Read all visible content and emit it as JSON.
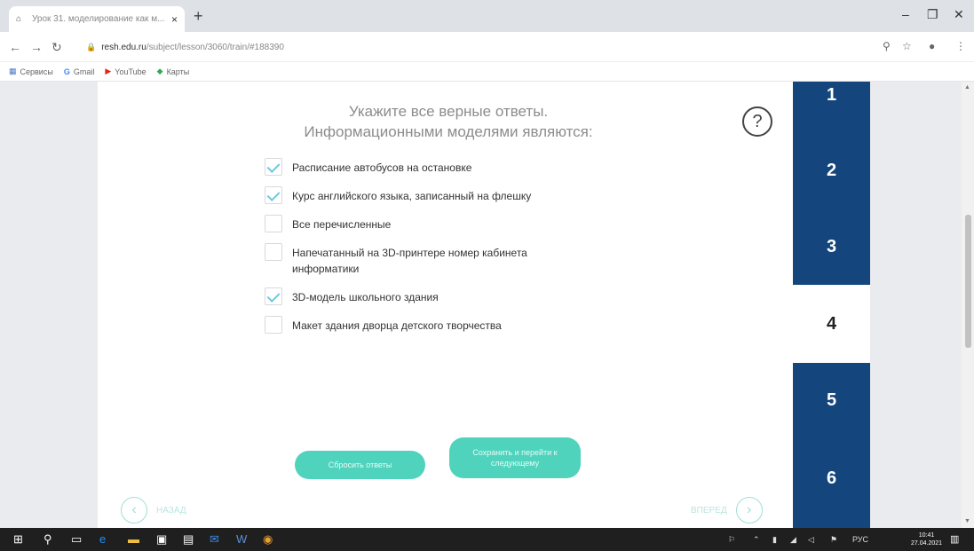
{
  "browser": {
    "tab_title": "Урок 31. моделирование как м...",
    "tab_close": "×",
    "new_tab": "+",
    "url_host": "resh.edu.ru",
    "url_path": "/subject/lesson/3060/train/#188390",
    "bookmarks": [
      {
        "icon": "apps-grid-icon",
        "label": "Сервисы"
      },
      {
        "icon": "google-icon",
        "label": "Gmail"
      },
      {
        "icon": "youtube-icon",
        "label": "YouTube"
      },
      {
        "icon": "maps-icon",
        "label": "Карты"
      }
    ]
  },
  "question": {
    "line1": "Укажите все верные ответы.",
    "line2": "Информационными моделями являются:",
    "help": "?"
  },
  "options": [
    {
      "label": "Расписание автобусов на остановке",
      "checked": true
    },
    {
      "label": "Курс английского языка, записанный на флешку",
      "checked": true
    },
    {
      "label": "Все перечисленные",
      "checked": false
    },
    {
      "label": "Напечатанный на 3D-принтере номер кабинета информатики",
      "checked": false
    },
    {
      "label": "3D-модель школьного здания",
      "checked": true
    },
    {
      "label": "Макет здания дворца детского творчества",
      "checked": false
    }
  ],
  "buttons": {
    "reset": "Сбросить ответы",
    "save": "Сохранить и перейти к следующему"
  },
  "nav": {
    "back": "НАЗАД",
    "forward": "ВПЕРЕД"
  },
  "steps": [
    "1",
    "2",
    "3",
    "4",
    "5",
    "6"
  ],
  "current_step": "4",
  "taskbar": {
    "lang": "РУС",
    "time": "10:41",
    "date": "27.04.2021"
  },
  "colors": {
    "accent": "#4fd3bd",
    "step_bg": "#14467d",
    "check": "#6ec8df"
  }
}
